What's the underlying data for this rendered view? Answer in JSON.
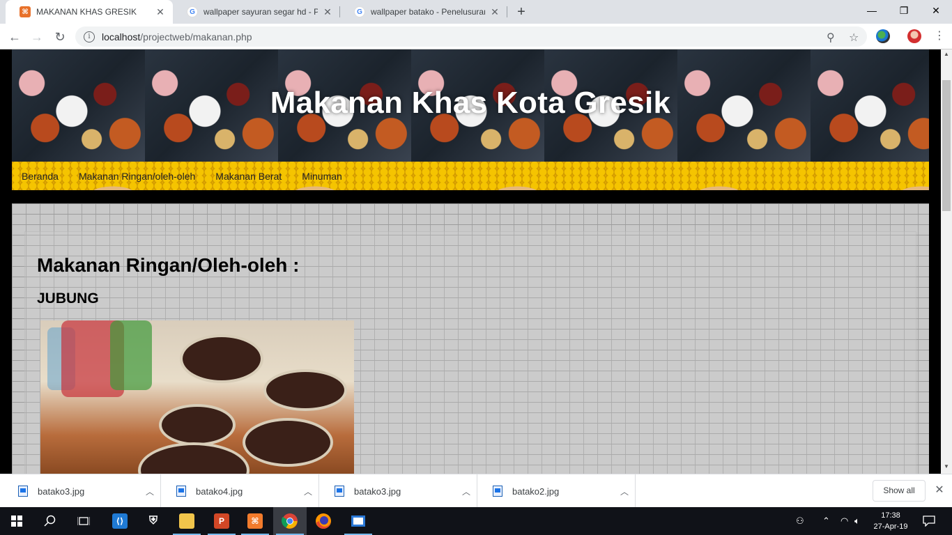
{
  "browser": {
    "tabs": [
      {
        "title": "MAKANAN KHAS GRESIK",
        "active": true,
        "favicon": "xampp-icon"
      },
      {
        "title": "wallpaper sayuran segar hd - Pen",
        "active": false,
        "favicon": "google-icon"
      },
      {
        "title": "wallpaper batako - Penelusuran G",
        "active": false,
        "favicon": "google-icon"
      }
    ],
    "new_tab_glyph": "+",
    "window_controls": {
      "minimize": "—",
      "restore": "❐",
      "close": "✕"
    },
    "address": {
      "host": "localhost",
      "path": "/projectweb/makanan.php"
    },
    "nav": {
      "back": "←",
      "forward": "→",
      "reload": "↻"
    },
    "omnibox_icons": {
      "zoom": "⚲",
      "bookmark": "☆"
    }
  },
  "page": {
    "site_title": "Makanan Khas Kota Gresik",
    "menu": [
      "Beranda",
      "Makanan Ringan/oleh-oleh",
      "Makanan Berat",
      "Minuman"
    ],
    "section_heading": "Makanan Ringan/Oleh-oleh :",
    "item_title": "JUBUNG",
    "colors": {
      "nav_bg": "#e2a900",
      "title_color": "#ffffff",
      "page_bg": "#000000"
    }
  },
  "downloads": {
    "items": [
      {
        "name": "batako3.jpg"
      },
      {
        "name": "batako4.jpg"
      },
      {
        "name": "batako3.jpg"
      },
      {
        "name": "batako2.jpg"
      }
    ],
    "show_all": "Show all",
    "close_glyph": "✕"
  },
  "taskbar": {
    "clock_time": "17:38",
    "clock_date": "27-Apr-19",
    "apps": [
      "start-icon",
      "search-icon",
      "task-view-icon",
      "vscode-icon",
      "security-icon",
      "file-explorer-icon",
      "powerpoint-icon",
      "xampp-icon",
      "chrome-icon",
      "firefox-icon",
      "app-window-icon"
    ]
  }
}
